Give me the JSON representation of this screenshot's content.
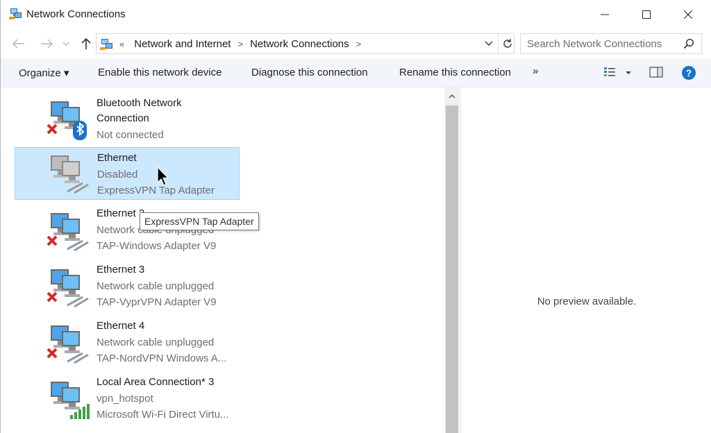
{
  "window": {
    "title": "Network Connections"
  },
  "address": {
    "overflow_glyph": "«",
    "crumbs": [
      "Network and Internet",
      "Network Connections"
    ],
    "separator": ">"
  },
  "search": {
    "placeholder": "Search Network Connections"
  },
  "toolbar": {
    "organize": "Organize ▾",
    "enable": "Enable this network device",
    "diagnose": "Diagnose this connection",
    "rename": "Rename this connection",
    "more": "»",
    "help": "?"
  },
  "connections": [
    {
      "name": "Bluetooth Network",
      "name2": "Connection",
      "status": "Not connected",
      "icon": "bluetooth-network-icon",
      "disconnected": true
    },
    {
      "name": "Ethernet",
      "status": "Disabled",
      "adapter": "ExpressVPN Tap Adapter",
      "icon": "ethernet-disabled-icon",
      "selected": true
    },
    {
      "name": "Ethernet 2",
      "status": "Network cable unplugged",
      "adapter": "TAP-Windows Adapter V9",
      "icon": "ethernet-unplugged-icon",
      "disconnected": true
    },
    {
      "name": "Ethernet 3",
      "status": "Network cable unplugged",
      "adapter": "TAP-VyprVPN Adapter V9",
      "icon": "ethernet-unplugged-icon",
      "disconnected": true
    },
    {
      "name": "Ethernet 4",
      "status": "Network cable unplugged",
      "adapter": "TAP-NordVPN Windows A...",
      "icon": "ethernet-unplugged-icon",
      "disconnected": true
    },
    {
      "name": "Local Area Connection* 3",
      "status": "vpn_hotspot",
      "adapter": "Microsoft Wi-Fi Direct Virtu...",
      "icon": "wifi-direct-icon"
    }
  ],
  "tooltip": "ExpressVPN Tap Adapter",
  "preview": {
    "message": "No preview available."
  },
  "colors": {
    "selection": "#cce8ff",
    "toolbar_bg": "#f2f6fb",
    "error_red": "#d42a2a",
    "bluetooth_blue": "#1a73c9"
  }
}
